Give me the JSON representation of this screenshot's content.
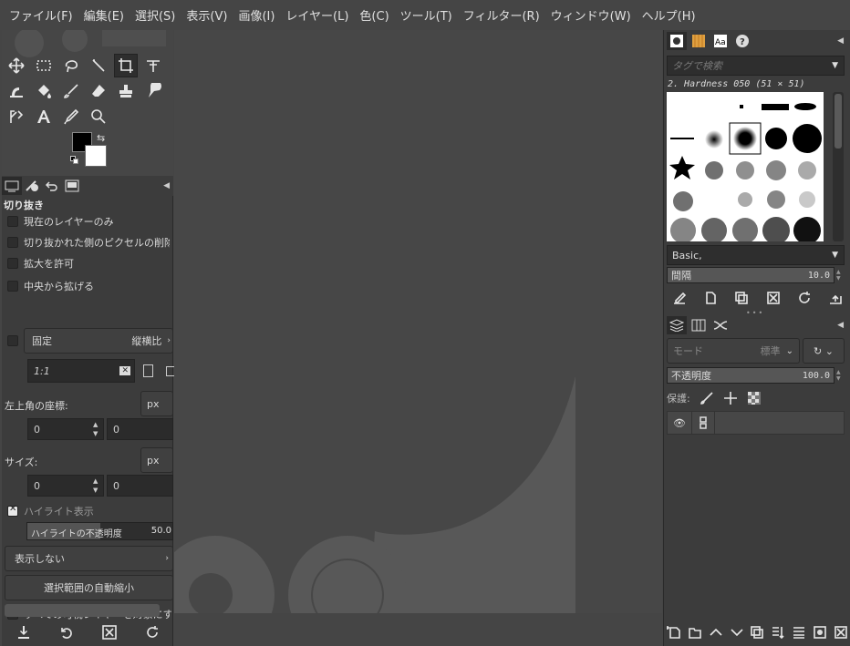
{
  "menu": [
    "ファイル(F)",
    "編集(E)",
    "選択(S)",
    "表示(V)",
    "画像(I)",
    "レイヤー(L)",
    "色(C)",
    "ツール(T)",
    "フィルター(R)",
    "ウィンドウ(W)",
    "ヘルプ(H)"
  ],
  "tool_options": {
    "title": "切り抜き",
    "current_layer_only": "現在のレイヤーのみ",
    "delete_cropped": "切り抜かれた側のピクセルの削除",
    "allow_growing": "拡大を許可",
    "expand_from_center": "中央から拡げる",
    "fixed": "固定",
    "fixed_mode": "縦横比",
    "ratio_value": "1:1",
    "position_label": "左上角の座標:",
    "position_unit": "px",
    "position_x": "0",
    "position_y": "0",
    "size_label": "サイズ:",
    "size_unit": "px",
    "size_w": "0",
    "size_h": "0",
    "highlight": "ハイライト表示",
    "highlight_opacity_label": "ハイライトの不透明度",
    "highlight_opacity_value": "50.0",
    "guides": "表示しない",
    "auto_shrink": "選択範囲の自動縮小",
    "shrink_merged": "すべての可視レイヤーを対象にする"
  },
  "brushes": {
    "filter_placeholder": "タグで検索",
    "selected_brush": "2. Hardness 050 (51 × 51)",
    "preset": "Basic,",
    "spacing_label": "間隔",
    "spacing_value": "10.0"
  },
  "layers": {
    "mode_label": "モード",
    "mode_value": "標準",
    "opacity_label": "不透明度",
    "opacity_value": "100.0",
    "lock_label": "保護:"
  },
  "colors": {
    "fg": "#000000",
    "bg": "#ffffff",
    "accent": "#e6e6e6"
  }
}
